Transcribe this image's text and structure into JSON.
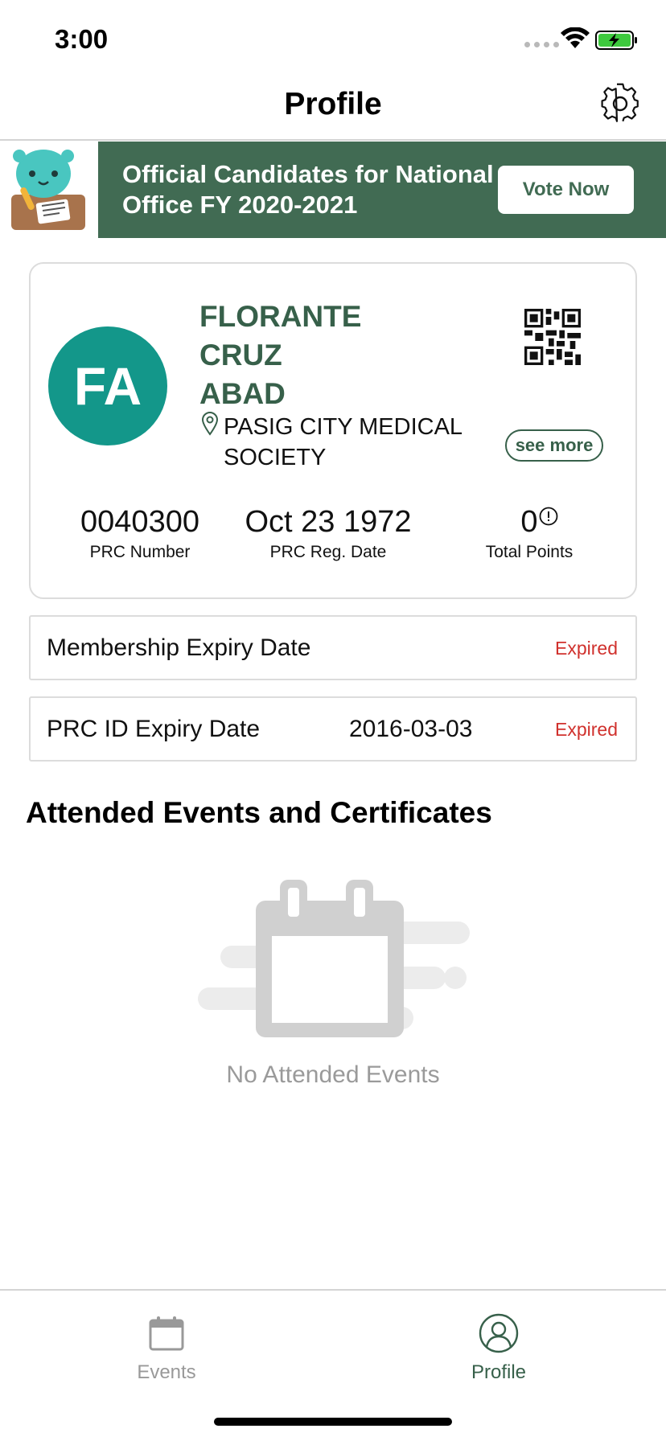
{
  "status_bar": {
    "time": "3:00"
  },
  "nav": {
    "title": "Profile"
  },
  "banner": {
    "text": "Official Candidates for National Office FY 2020-2021",
    "button_label": "Vote Now"
  },
  "profile": {
    "initials": "FA",
    "name_lines": [
      "FLORANTE",
      "CRUZ",
      "ABAD"
    ],
    "society": "PASIG CITY MEDICAL SOCIETY",
    "see_more_label": "see more",
    "stats": {
      "prc_number": {
        "value": "0040300",
        "label": "PRC Number"
      },
      "prc_reg_date": {
        "value": "Oct 23 1972",
        "label": "PRC Reg. Date"
      },
      "total_points": {
        "value": "0",
        "label": "Total Points"
      }
    }
  },
  "expiry": {
    "membership": {
      "label": "Membership Expiry Date",
      "date": "",
      "status": "Expired"
    },
    "prc_id": {
      "label": "PRC ID Expiry Date",
      "date": "2016-03-03",
      "status": "Expired"
    }
  },
  "events": {
    "heading": "Attended Events and Certificates",
    "empty_text": "No Attended Events"
  },
  "tab_bar": {
    "tabs": [
      {
        "label": "Events",
        "icon": "calendar-icon",
        "active": false
      },
      {
        "label": "Profile",
        "icon": "person-circle-icon",
        "active": true
      }
    ]
  },
  "colors": {
    "brand_green": "#416b53",
    "avatar_teal": "#13978a",
    "expired_red": "#d0312d"
  }
}
